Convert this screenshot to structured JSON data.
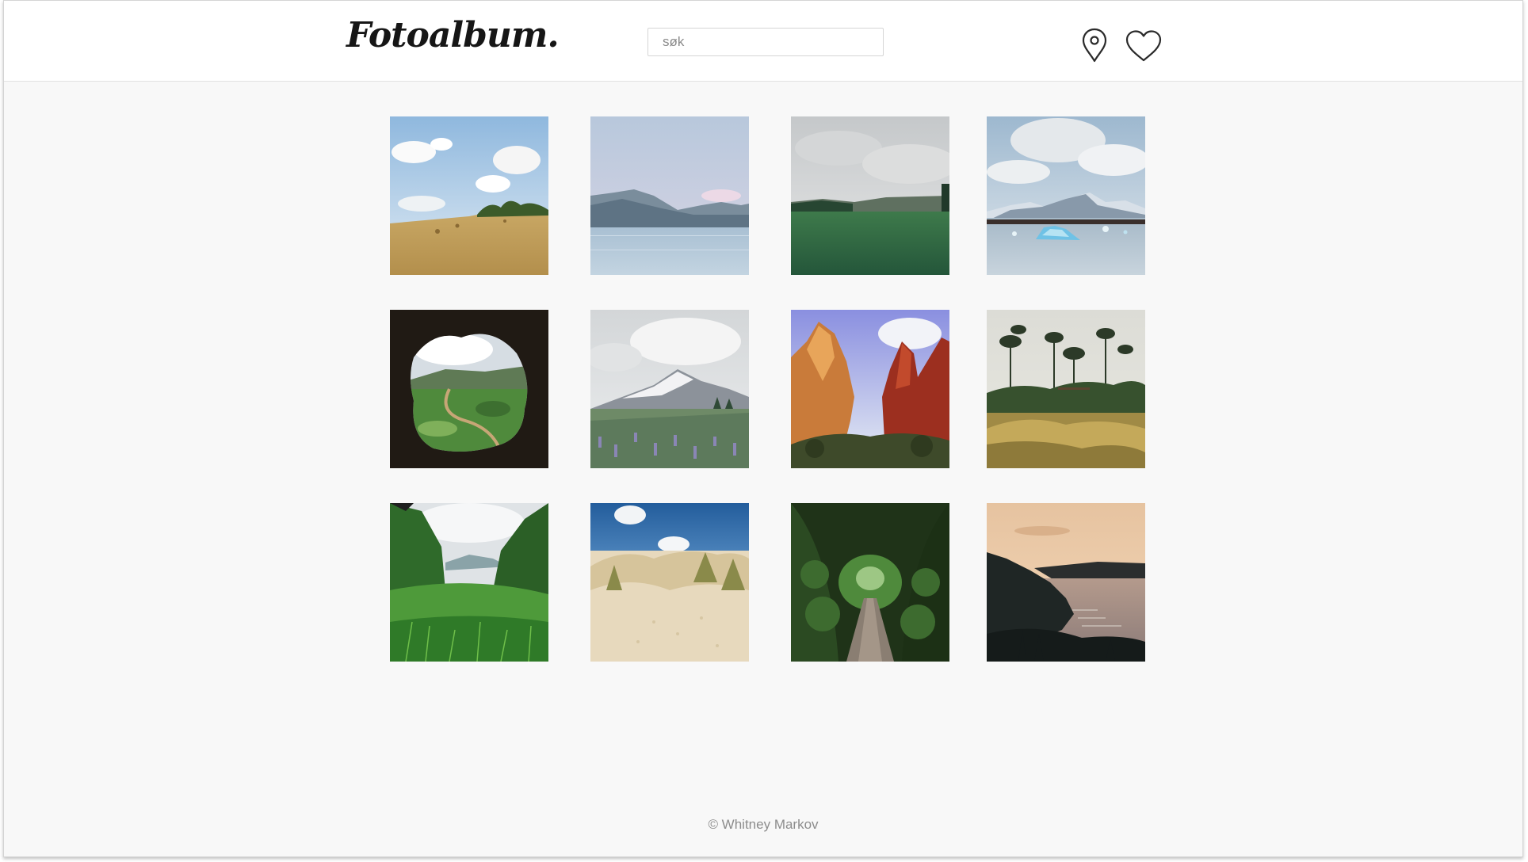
{
  "header": {
    "logo": "Fotoalbum.",
    "search_placeholder": "søk",
    "location_icon": "map-pin-icon",
    "favorites_icon": "heart-icon"
  },
  "photos": [
    {
      "scene": "wheat field with hay bales under blue sky and clouds"
    },
    {
      "scene": "calm lake with mountains under pastel sky"
    },
    {
      "scene": "green meadow under overcast sky"
    },
    {
      "scene": "glacier lagoon with icebergs and snowy mountains"
    },
    {
      "scene": "view from dark cave opening onto green valley"
    },
    {
      "scene": "lupine field with snowy mountain and clouds"
    },
    {
      "scene": "red rock canyon cliffs at sunset"
    },
    {
      "scene": "garden with tall trees and golden grasses"
    },
    {
      "scene": "lush green jungle valley with grass"
    },
    {
      "scene": "sand dunes with beach grass under blue sky"
    },
    {
      "scene": "narrow path through dense green forest"
    },
    {
      "scene": "coastline cliffs and sea at dusk"
    }
  ],
  "footer": {
    "copyright": "© Whitney Markov"
  },
  "colors": {
    "background": "#f8f8f8",
    "header_background": "#ffffff",
    "logo": "#161616",
    "footer_text": "#8c8c8c"
  }
}
